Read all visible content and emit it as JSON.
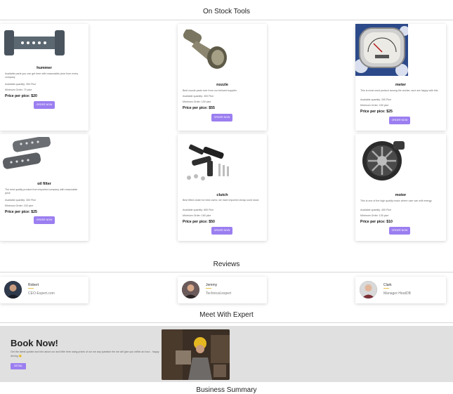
{
  "sections": {
    "tools_title": "On Stock Tools",
    "reviews_title": "Reviews",
    "expert_title": "Meet With Expert",
    "summary_title": "Business Summary"
  },
  "tools": [
    {
      "name": "hummer",
      "icon": "hammer-tool-image",
      "desc": "Available parts you can get here with reasonable price from every company",
      "qty": "Available quantity: 300 Pice",
      "moq": "Minimum Order: 70 pice",
      "price": "Price per pice: $20",
      "order": "ORDER NOW"
    },
    {
      "name": "nozzle",
      "icon": "nozzle-tool-image",
      "desc": "Best nozzle parts ever from our beloved supplier",
      "qty": "Available quantity: 300 Pice",
      "moq": "Minimum Order: 100 pice",
      "price": "Price per pice: $55",
      "order": "ORDER NOW"
    },
    {
      "name": "meter",
      "icon": "speedometer-image",
      "desc": "This is most used product among the worker, sure are happy with this",
      "qty": "Available quantity: 200 Pice",
      "moq": "Minimum Order: 150 pice",
      "price": "Price per pice: $25",
      "order": "ORDER NOW"
    },
    {
      "name": "oil filter",
      "icon": "oil-filter-image",
      "desc": "The best quality product from imported company with reasonable price",
      "qty": "Available quantity: 300 Pice",
      "moq": "Minimum Order: 100 pice",
      "price": "Price per pice: $25",
      "order": "ORDER NOW"
    },
    {
      "name": "clutch",
      "icon": "clutch-parts-image",
      "desc": "Best fitted clutch for best users; we have imported cheap used stock",
      "qty": "Available quantity: 650 Pice",
      "moq": "Minimum Order: 160 pice",
      "price": "Price per pice: $50",
      "order": "ORDER NOW"
    },
    {
      "name": "motor",
      "icon": "motor-engine-image",
      "desc": "This is one of the high quality motor where user can with energy",
      "qty": "Available quantity: 400 Pice",
      "moq": "Minimum Order: 130 pice",
      "price": "Price per pice: $10",
      "order": "ORDER NOW"
    }
  ],
  "reviews": [
    {
      "name": "Robert",
      "role": "CEO-Expert.com",
      "avatar": "avatar-robert"
    },
    {
      "name": "Jemmy",
      "role": "Technical.expert",
      "avatar": "avatar-jemmy"
    },
    {
      "name": "Clark",
      "role": "Manager-HeatDB",
      "avatar": "avatar-clark"
    }
  ],
  "book": {
    "title": "Book Now!",
    "text": "Get the latest update and info about our and little here using prices of our we any question the we will give you within an hour - happy driving 🙂",
    "button": "DETAIL",
    "image": "mechanic-photo"
  },
  "colors": {
    "accent": "#9b7ef0",
    "band": "#e0e0e0"
  }
}
